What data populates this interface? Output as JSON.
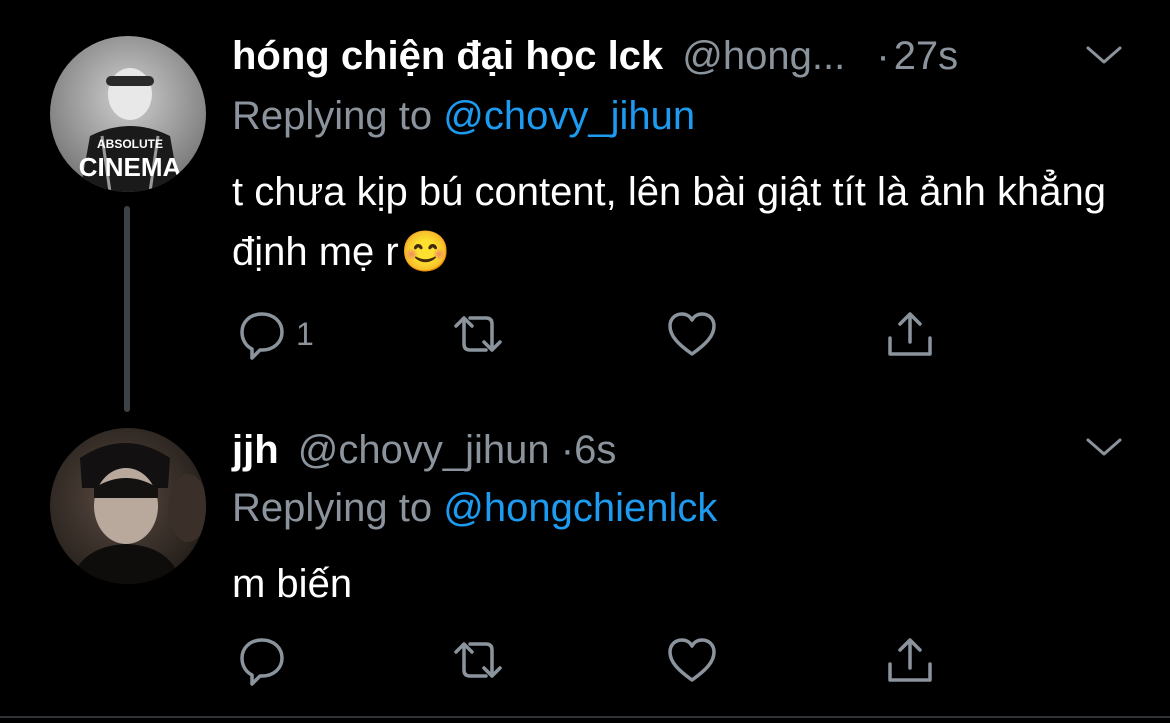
{
  "tweets": [
    {
      "display_name": "hóng chiện đại học lck",
      "handle": "@hong...",
      "separator": "·",
      "time": "27s",
      "replying_label": "Replying to",
      "replying_to": "@chovy_jihun",
      "text": "t chưa kịp bú content, lên bài giật tít là ảnh khẳng định mẹ r",
      "emoji": "😊",
      "avatar_text": [
        "ABSOLUTE",
        "CINEMA"
      ],
      "reply_count": "1",
      "icons": [
        "reply-icon",
        "retweet-icon",
        "like-icon",
        "share-icon",
        "chevron-down-icon"
      ]
    },
    {
      "display_name": "jjh",
      "handle": "@chovy_jihun",
      "separator": "·",
      "time": "6s",
      "replying_label": "Replying to",
      "replying_to": "@hongchienlck",
      "text": "m biến",
      "reply_count": "",
      "icons": [
        "reply-icon",
        "retweet-icon",
        "like-icon",
        "share-icon",
        "chevron-down-icon"
      ]
    }
  ],
  "colors": {
    "background": "#000000",
    "primary_text": "#ffffff",
    "secondary_text": "#8b949c",
    "mention": "#1d9bf0",
    "thread_line": "#3d4246"
  }
}
